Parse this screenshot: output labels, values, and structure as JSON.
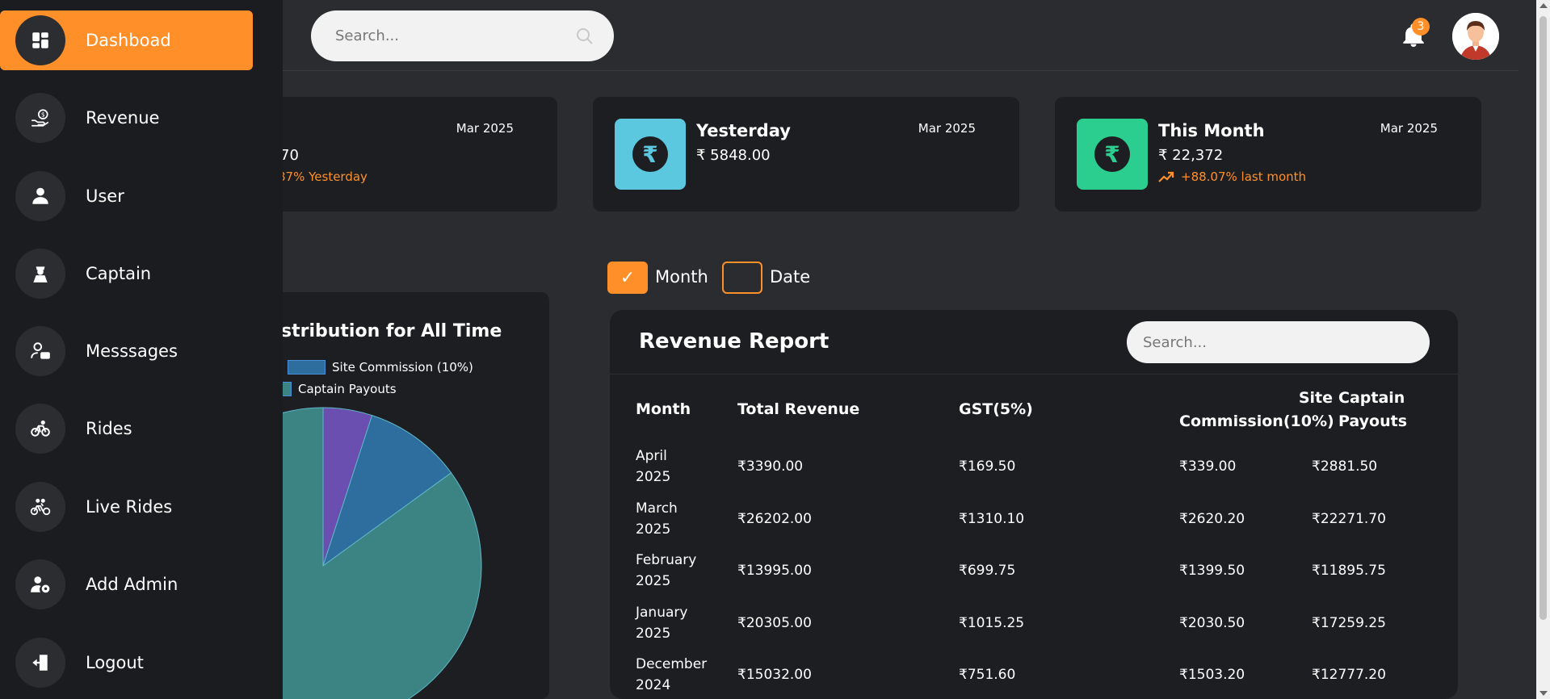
{
  "sidebar": {
    "items": [
      {
        "label": "Dashboad",
        "icon": "dashboard-icon",
        "active": true
      },
      {
        "label": "Revenue",
        "icon": "revenue-icon"
      },
      {
        "label": "User",
        "icon": "user-icon"
      },
      {
        "label": "Captain",
        "icon": "captain-icon"
      },
      {
        "label": "Messsages",
        "icon": "messages-icon"
      },
      {
        "label": "Rides",
        "icon": "rides-icon"
      },
      {
        "label": "Live Rides",
        "icon": "live-rides-icon"
      },
      {
        "label": "Add Admin",
        "icon": "add-admin-icon"
      },
      {
        "label": "Logout",
        "icon": "logout-icon"
      }
    ]
  },
  "header": {
    "search_placeholder": "Search...",
    "notification_count": "3"
  },
  "cards": [
    {
      "title": "",
      "date": "Mar 2025",
      "value": "70",
      "change": "87% Yesterday",
      "icon_color": "#5bc8e0"
    },
    {
      "title": "Yesterday",
      "date": "Mar 2025",
      "value": "₹ 5848.00",
      "change": "",
      "icon_color": "#5bc8e0"
    },
    {
      "title": "This Month",
      "date": "Mar 2025",
      "value": "₹ 22,372",
      "change": "+88.07% last month",
      "icon_color": "#2bce8f"
    }
  ],
  "card_icon_glyph": "₹",
  "chart_data": {
    "type": "pie",
    "title": "stribution for All Time",
    "legend": [
      "Site Commission (10%)",
      "Captain Payouts"
    ],
    "slices": [
      {
        "name": "",
        "value": 5,
        "color": "#6a4fb0"
      },
      {
        "name": "Site Commission (10%)",
        "value": 10,
        "color": "#2e6e9e"
      },
      {
        "name": "Captain Payouts",
        "value": 85,
        "color": "#3c8484"
      }
    ]
  },
  "filters": {
    "month_label": "Month",
    "date_label": "Date",
    "month_checked": true,
    "date_checked": false,
    "check_glyph": "✓"
  },
  "report": {
    "title": "Revenue Report",
    "search_placeholder": "Search...",
    "headers": {
      "month": "Month",
      "total_revenue": "Total Revenue",
      "gst": "GST(5%)",
      "site_commission_1": "Site",
      "site_commission_2": "Commission(10%)",
      "captain_payouts_1": "Captain",
      "captain_payouts_2": "Payouts"
    },
    "rows": [
      {
        "month_1": "April",
        "month_2": "2025",
        "total": "₹3390.00",
        "gst": "₹169.50",
        "commission": "₹339.00",
        "payouts": "₹2881.50"
      },
      {
        "month_1": "March",
        "month_2": "2025",
        "total": "₹26202.00",
        "gst": "₹1310.10",
        "commission": "₹2620.20",
        "payouts": "₹22271.70"
      },
      {
        "month_1": "February",
        "month_2": "2025",
        "total": "₹13995.00",
        "gst": "₹699.75",
        "commission": "₹1399.50",
        "payouts": "₹11895.75"
      },
      {
        "month_1": "January",
        "month_2": "2025",
        "total": "₹20305.00",
        "gst": "₹1015.25",
        "commission": "₹2030.50",
        "payouts": "₹17259.25"
      },
      {
        "month_1": "December",
        "month_2": "2024",
        "total": "₹15032.00",
        "gst": "₹751.60",
        "commission": "₹1503.20",
        "payouts": "₹12777.20"
      }
    ]
  },
  "colors": {
    "accent": "#ff9029",
    "sidebar_bg": "#1b1c1f",
    "page_bg": "#2a2c30",
    "card_bg": "#1d1e21"
  }
}
